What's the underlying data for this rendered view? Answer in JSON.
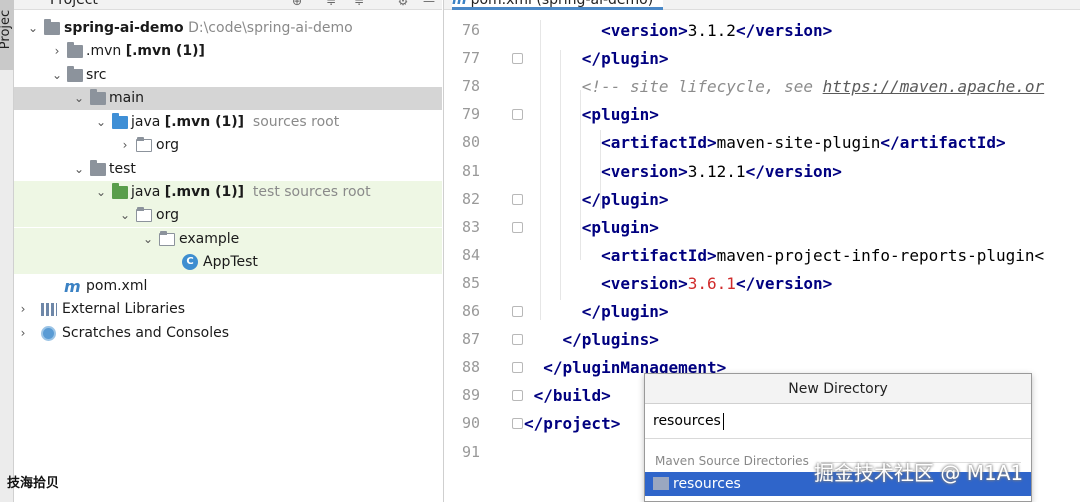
{
  "side_strip_label": "Projec",
  "project_panel": {
    "header_title": "Project",
    "tree": [
      {
        "label": "spring-ai-demo",
        "hint": "D:\\code\\spring-ai-demo"
      },
      {
        "label": ".mvn",
        "bold_suffix": "[.mvn (1)]"
      },
      {
        "label": "src"
      },
      {
        "label": "main"
      },
      {
        "label": "java",
        "bold_suffix": "[.mvn (1)]",
        "hint": "sources root"
      },
      {
        "label": "org"
      },
      {
        "label": "test"
      },
      {
        "label": "java",
        "bold_suffix": "[.mvn (1)]",
        "hint": "test sources root"
      },
      {
        "label": "org"
      },
      {
        "label": "example"
      },
      {
        "label": "AppTest"
      },
      {
        "label": "pom.xml"
      },
      {
        "label": "External Libraries"
      },
      {
        "label": "Scratches and Consoles"
      }
    ],
    "class_icon_letter": "C",
    "maven_icon_letter": "m"
  },
  "editor": {
    "tab_label": "pom.xml (spring-ai-demo)",
    "lines": [
      {
        "n": "76",
        "parts": [
          {
            "t": "        "
          },
          {
            "t": "<version>",
            "c": "tg"
          },
          {
            "t": "3.1.2"
          },
          {
            "t": "</version>",
            "c": "tg"
          }
        ]
      },
      {
        "n": "77",
        "parts": [
          {
            "t": "      "
          },
          {
            "t": "</plugin>",
            "c": "tg"
          }
        ]
      },
      {
        "n": "78",
        "parts": [
          {
            "t": "      "
          },
          {
            "t": "<!-- site lifecycle, see ",
            "c": "cm"
          },
          {
            "t": "https://maven.apache.or",
            "c": "cmu"
          }
        ]
      },
      {
        "n": "79",
        "parts": [
          {
            "t": "      "
          },
          {
            "t": "<plugin>",
            "c": "tg"
          }
        ]
      },
      {
        "n": "80",
        "parts": [
          {
            "t": "        "
          },
          {
            "t": "<artifactId>",
            "c": "tg"
          },
          {
            "t": "maven-site-plugin"
          },
          {
            "t": "</artifactId>",
            "c": "tg"
          }
        ]
      },
      {
        "n": "81",
        "parts": [
          {
            "t": "        "
          },
          {
            "t": "<version>",
            "c": "tg"
          },
          {
            "t": "3.12.1"
          },
          {
            "t": "</version>",
            "c": "tg"
          }
        ]
      },
      {
        "n": "82",
        "parts": [
          {
            "t": "      "
          },
          {
            "t": "</plugin>",
            "c": "tg"
          }
        ]
      },
      {
        "n": "83",
        "parts": [
          {
            "t": "      "
          },
          {
            "t": "<plugin>",
            "c": "tg"
          }
        ]
      },
      {
        "n": "84",
        "parts": [
          {
            "t": "        "
          },
          {
            "t": "<artifactId>",
            "c": "tg"
          },
          {
            "t": "maven-project-info-reports-plugin<"
          }
        ]
      },
      {
        "n": "85",
        "parts": [
          {
            "t": "        "
          },
          {
            "t": "<version>",
            "c": "tg"
          },
          {
            "t": "3.6.1",
            "c": "red"
          },
          {
            "t": "</version>",
            "c": "tg"
          }
        ]
      },
      {
        "n": "86",
        "parts": [
          {
            "t": "      "
          },
          {
            "t": "</plugin>",
            "c": "tg"
          }
        ]
      },
      {
        "n": "87",
        "parts": [
          {
            "t": "    "
          },
          {
            "t": "</plugins>",
            "c": "tg"
          }
        ]
      },
      {
        "n": "88",
        "parts": [
          {
            "t": "  "
          },
          {
            "t": "</pluginManagement>",
            "c": "tg"
          }
        ]
      },
      {
        "n": "89",
        "parts": [
          {
            "t": " "
          },
          {
            "t": "</build>",
            "c": "tg"
          }
        ]
      },
      {
        "n": "90",
        "parts": [
          {
            "t": "</project>",
            "c": "tg"
          }
        ]
      },
      {
        "n": "91",
        "parts": []
      }
    ]
  },
  "new_directory_popup": {
    "title": "New Directory",
    "input_value": "resources",
    "group_label": "Maven Source Directories",
    "suggestion": "resources"
  },
  "watermark": "掘金技术社区 @ M1A1",
  "bottom_left_text": "技海拾贝",
  "colors": {
    "selection": "#2f65ca",
    "arrow": "#e23b1e",
    "tag": "#000080"
  }
}
